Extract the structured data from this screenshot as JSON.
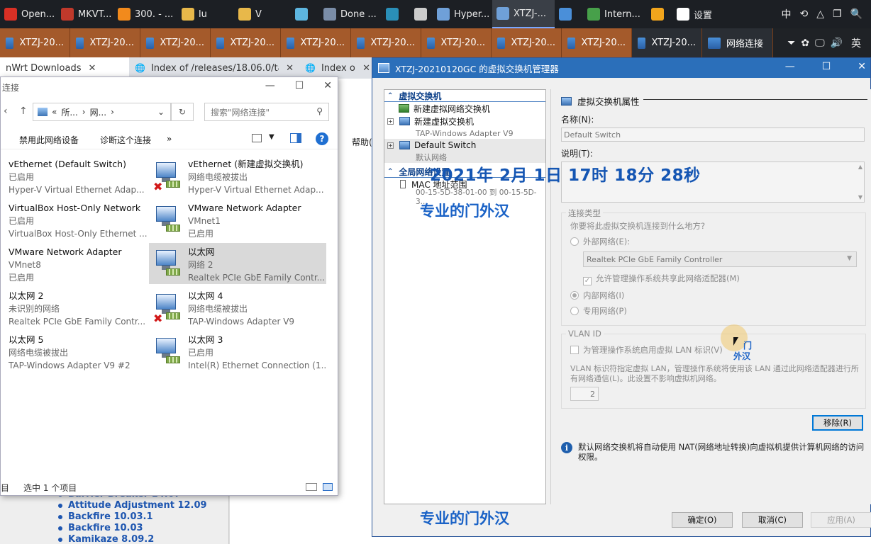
{
  "taskbar_top": [
    {
      "label": "Open...",
      "color": "#d93025",
      "icon": "opera-icon"
    },
    {
      "label": "MKVT...",
      "color": "#c0392b",
      "icon": "mkv-icon"
    },
    {
      "label": "300. - ...",
      "color": "#f28a1c",
      "icon": "search-app-icon"
    },
    {
      "label": "lu",
      "color": "#e8b84a",
      "icon": "folder-icon"
    },
    {
      "label": "V",
      "color": "#e8b84a",
      "icon": "folder-icon"
    },
    {
      "label": "",
      "color": "#5db6e0",
      "icon": "app-icon"
    },
    {
      "label": "Done ...",
      "color": "#7a8da8",
      "icon": "network-app-icon"
    },
    {
      "label": "",
      "color": "#2a8fb8",
      "icon": "chatgpt-icon"
    },
    {
      "label": "",
      "color": "#cccccc",
      "icon": "window-icon"
    },
    {
      "label": "Hyper...",
      "color": "#6fa0d8",
      "icon": "hyperv-icon"
    },
    {
      "label": "XTZJ-...",
      "color": "#6fa0d8",
      "icon": "vswitch-icon",
      "active": true
    },
    {
      "label": "",
      "color": "#4a8fd9",
      "icon": "remote-icon"
    },
    {
      "label": "Intern...",
      "color": "#47a04a",
      "icon": "ie-icon"
    },
    {
      "label": "",
      "color": "#f2a51c",
      "icon": "app-square-icon"
    },
    {
      "label": "设置",
      "color": "#ffffff",
      "icon": "gear-icon"
    }
  ],
  "taskbar_tray_top": [
    "中",
    "⟲",
    "△",
    "❐",
    "🔍"
  ],
  "taskbar_second": [
    {
      "label": "XTZJ-20..."
    },
    {
      "label": "XTZJ-20..."
    },
    {
      "label": "XTZJ-20..."
    },
    {
      "label": "XTZJ-20..."
    },
    {
      "label": "XTZJ-20..."
    },
    {
      "label": "XTZJ-20..."
    },
    {
      "label": "XTZJ-20..."
    },
    {
      "label": "XTZJ-20..."
    },
    {
      "label": "XTZJ-20..."
    },
    {
      "label": "XTZJ-20...",
      "dark": true
    },
    {
      "label": "网络连接",
      "dark": true
    }
  ],
  "tray_lang": "英",
  "browser": {
    "tabs": [
      {
        "label": "nWrt Downloads",
        "current": true
      },
      {
        "label": "Index of /releases/18.06.0/targ"
      },
      {
        "label": "Index of /rel"
      }
    ],
    "releases": [
      "Barrier Breaker 14.07",
      "Attitude Adjustment 12.09",
      "Backfire 10.03.1",
      "Backfire 10.03",
      "Kamikaze 8.09.2"
    ],
    "help_menu": "帮助("
  },
  "netwin": {
    "title": "连接",
    "addr_prefix": "«",
    "addr_parts": [
      "所...",
      "网..."
    ],
    "search_placeholder": "搜索\"网络连接\"",
    "cmd": [
      "禁用此网络设备",
      "诊断这个连接",
      "»"
    ],
    "adapters": [
      {
        "name": "vEthernet (Default Switch)",
        "status": "已启用",
        "desc": "Hyper-V Virtual Ethernet Adap..."
      },
      {
        "name": "vEthernet (新建虚拟交换机)",
        "status": "网络电缆被拔出",
        "desc": "Hyper-V Virtual Ethernet Adap..."
      },
      {
        "name": "VirtualBox Host-Only Network",
        "status": "已启用",
        "desc": "VirtualBox Host-Only Ethernet ..."
      },
      {
        "name": "VMware Network Adapter",
        "status": "VMnet1",
        "desc": "已启用"
      },
      {
        "name": "VMware Network Adapter",
        "status": "VMnet8",
        "desc": "已启用"
      },
      {
        "name": "以太网",
        "status": "网络 2",
        "desc": "Realtek PCIe GbE Family Contr..."
      },
      {
        "name": "以太网 2",
        "status": "未识别的网络",
        "desc": "Realtek PCIe GbE Family Contr..."
      },
      {
        "name": "以太网 4",
        "status": "网络电缆被拔出",
        "desc": "TAP-Windows Adapter V9"
      },
      {
        "name": "以太网 5",
        "status": "网络电缆被拔出",
        "desc": "TAP-Windows Adapter V9 #2"
      },
      {
        "name": "以太网 3",
        "status": "已启用",
        "desc": "Intel(R) Ethernet Connection (1..."
      }
    ],
    "status_left": "目",
    "status_selected": "选中 1 个项目"
  },
  "vsm": {
    "title": "XTZJ-20210120GC 的虚拟交换机管理器",
    "section_switches": "虚拟交换机",
    "new_switch": "新建虚拟网络交换机",
    "switch1_name": "新建虚拟交换机",
    "switch1_sub": "TAP-Windows Adapter V9",
    "switch2_name": "Default Switch",
    "switch2_sub": "默认网络",
    "section_global": "全局网络设置",
    "mac_label": "MAC 地址范围",
    "mac_range": "00-15-5D-38-01-00 到 00-15-5D-3...",
    "props_head": "虚拟交换机属性",
    "name_label": "名称(N):",
    "name_value": "Default Switch",
    "desc_label": "说明(T):",
    "conn_type": "连接类型",
    "conn_question": "你要将此虚拟交换机连接到什么地方?",
    "external": "外部网络(E):",
    "external_nic": "Realtek PCIe GbE Family Controller",
    "allow_mgmt": "允许管理操作系统共享此网络适配器(M)",
    "internal": "内部网络(I)",
    "private": "专用网络(P)",
    "vlan_group": "VLAN ID",
    "vlan_enable": "为管理操作系统启用虚拟 LAN 标识(V)",
    "vlan_desc": "VLAN 标识符指定虚拟 LAN，管理操作系统将使用该 LAN 通过此网络适配器进行所有网络通信(L)。此设置不影响虚拟机网络。",
    "vlan_value": "2",
    "remove_btn": "移除(R)",
    "info_text": "默认网络交换机将自动使用 NAT(网络地址转换)向虚拟机提供计算机网络的访问权限。",
    "ok": "确定(O)",
    "cancel": "取消(C)",
    "apply": "应用(A)"
  },
  "overlay": {
    "timestamp": "2021年 2月 1日 17时 18分 28秒",
    "watermark": "专业的门外汉",
    "cursor_text1": "门",
    "cursor_text2": "外汉"
  }
}
